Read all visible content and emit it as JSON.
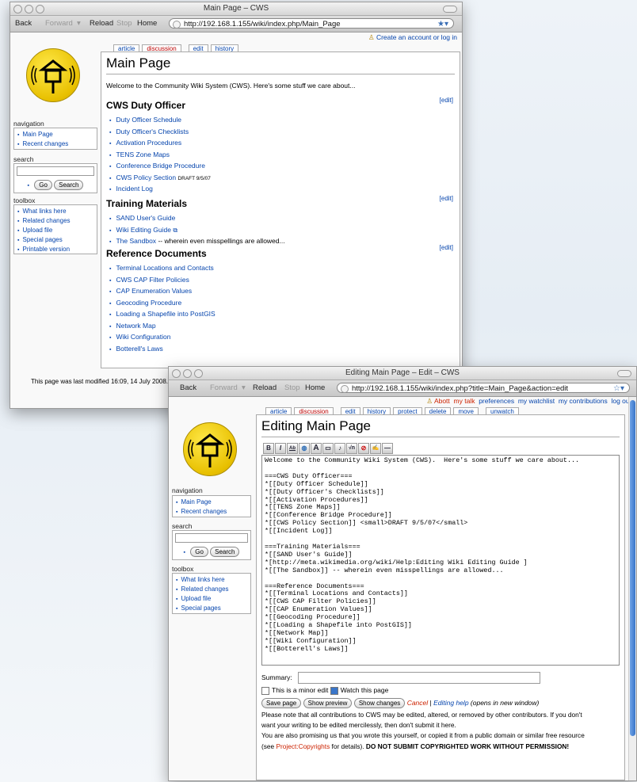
{
  "win1": {
    "title": "Main Page – CWS",
    "back": "Back",
    "forward": "Forward",
    "reload": "Reload",
    "stop": "Stop",
    "home": "Home",
    "url": "http://192.168.1.155/wiki/index.php/Main_Page",
    "create_account": "Create an account or log in",
    "tabs": [
      "article",
      "discussion",
      "edit",
      "history"
    ],
    "page_title": "Main Page",
    "welcome": "Welcome to the Community Wiki System (CWS). Here's some stuff we care about...",
    "edit_link": "[edit]",
    "sections": [
      {
        "heading": "CWS Duty Officer",
        "items": [
          "Duty Officer Schedule",
          "Duty Officer's Checklists",
          "Activation Procedures",
          "TENS Zone Maps",
          "Conference Bridge Procedure",
          "CWS Policy Section",
          "Incident Log"
        ],
        "note": "DRAFT 9/5/07"
      },
      {
        "heading": "Training Materials",
        "items": [
          "SAND User's Guide",
          "Wiki Editing Guide",
          "The Sandbox"
        ],
        "sandbox_note": "-- wherein even misspellings are allowed..."
      },
      {
        "heading": "Reference Documents",
        "items": [
          "Terminal Locations and Contacts",
          "CWS CAP Filter Policies",
          "CAP Enumeration Values",
          "Geocoding Procedure",
          "Loading a Shapefile into PostGIS",
          "Network Map",
          "Wiki Configuration",
          "Botterell's Laws"
        ]
      }
    ],
    "navigation_title": "navigation",
    "nav_items": [
      "Main Page",
      "Recent changes"
    ],
    "search_title": "search",
    "go_button": "Go",
    "search_button": "Search",
    "toolbox_title": "toolbox",
    "toolbox_items": [
      "What links here",
      "Related changes",
      "Upload file",
      "Special pages",
      "Printable version"
    ],
    "footer": "This page was last modified 16:09, 14 July 2008."
  },
  "win2": {
    "title": "Editing Main Page – Edit – CWS",
    "back": "Back",
    "forward": "Forward",
    "reload": "Reload",
    "stop": "Stop",
    "home": "Home",
    "url": "http://192.168.1.155/wiki/index.php?title=Main_Page&action=edit",
    "user": "Abott",
    "user_links": [
      "my talk",
      "preferences",
      "my watchlist",
      "my contributions",
      "log out"
    ],
    "tabs": [
      "article",
      "discussion",
      "edit",
      "history",
      "protect",
      "delete",
      "move",
      "unwatch"
    ],
    "page_title": "Editing Main Page",
    "wikitext": "Welcome to the Community Wiki System (CWS).  Here's some stuff we care about...\n\n===CWS Duty Officer===\n*[[Duty Officer Schedule]]\n*[[Duty Officer's Checklists]]\n*[[Activation Procedures]]\n*[[TENS Zone Maps]]\n*[[Conference Bridge Procedure]]\n*[[CWS Policy Section]] <small>DRAFT 9/5/07</small>\n*[[Incident Log]]\n\n===Training Materials===\n*[[SAND User's Guide]]\n*[http://meta.wikimedia.org/wiki/Help:Editing Wiki Editing Guide ]\n*[[The Sandbox]] -- wherein even misspellings are allowed...\n\n===Reference Documents===\n*[[Terminal Locations and Contacts]]\n*[[CWS CAP Filter Policies]]\n*[[CAP Enumeration Values]]\n*[[Geocoding Procedure]]\n*[[Loading a Shapefile into PostGIS]]\n*[[Network Map]]\n*[[Wiki Configuration]]\n*[[Botterell's Laws]]",
    "summary_label": "Summary:",
    "minor_edit": "This is a minor edit",
    "watch_page": "Watch this page",
    "save_page": "Save page",
    "show_preview": "Show preview",
    "show_changes": "Show changes",
    "cancel": "Cancel",
    "separator": "|",
    "editing_help": "Editing help",
    "opens_new_window": "(opens in new window)",
    "notice1": "Please note that all contributions to CWS may be edited, altered, or removed by other contributors. If you don't",
    "notice2": "want your writing to be edited mercilessly, then don't submit it here.",
    "notice3": "You are also promising us that you wrote this yourself, or copied it from a public domain or similar free resource",
    "notice4_pre": "(see ",
    "notice4_link": "Project:Copyrights",
    "notice4_mid": " for details). ",
    "notice4_bold": "DO NOT SUBMIT COPYRIGHTED WORK WITHOUT PERMISSION!",
    "navigation_title": "navigation",
    "nav_items": [
      "Main Page",
      "Recent changes"
    ],
    "search_title": "search",
    "go_button": "Go",
    "search_button": "Search",
    "toolbox_title": "toolbox",
    "toolbox_items": [
      "What links here",
      "Related changes",
      "Upload file",
      "Special pages"
    ]
  },
  "colors": {
    "link": "#0645ad",
    "new_link": "#cc2200",
    "logo_yellow": "#f2d21a"
  },
  "icons": [
    "user-icon",
    "bookmark-star-icon",
    "external-link-icon",
    "cws-logo-icon"
  ]
}
